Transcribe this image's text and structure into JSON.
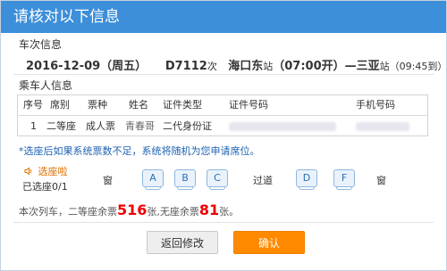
{
  "dialog": {
    "title": "请核对以下信息"
  },
  "train_info": {
    "section_title": "车次信息",
    "date": "2016-12-09（周五）",
    "train_number": "D7112",
    "train_suffix": "次",
    "from_station": "海口东",
    "from_suffix": "站",
    "depart_time": "（07:00开）",
    "separator": "—",
    "to_station": "三亚",
    "to_suffix": "站",
    "arrive_time": "（09:45到）"
  },
  "passengers": {
    "section_title": "乘车人信息",
    "headers": [
      "序号",
      "席别",
      "票种",
      "姓名",
      "证件类型",
      "证件号码",
      "手机号码"
    ],
    "rows": [
      {
        "index": "1",
        "seat_class": "二等座",
        "ticket_type": "成人票",
        "name": "青春哥",
        "id_type": "二代身份证"
      }
    ]
  },
  "notice": "*选座后如果系统票数不足，系统将随机为您申请席位。",
  "seat_selection": {
    "title": "选座啦",
    "selected": "已选座0/1",
    "window_left": "窗",
    "aisle": "过道",
    "window_right": "窗",
    "seats_left": [
      "A",
      "B",
      "C"
    ],
    "seats_right": [
      "D",
      "F"
    ]
  },
  "remaining": {
    "prefix": "本次列车，二等座余票",
    "second_class_count": "516",
    "mid": "张,无座余票",
    "no_seat_count": "81",
    "suffix": "张。"
  },
  "buttons": {
    "back": "返回修改",
    "confirm": "确认"
  }
}
